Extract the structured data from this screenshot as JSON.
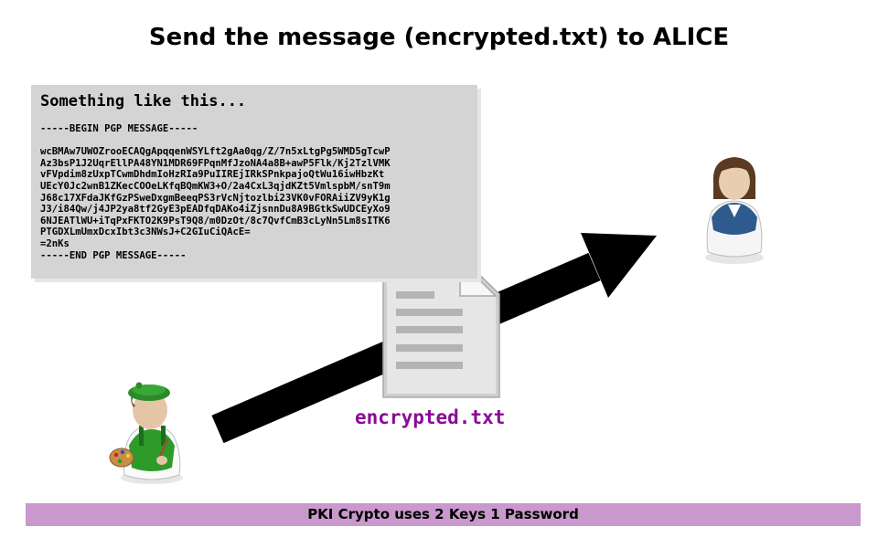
{
  "title": "Send the message (encrypted.txt) to ALICE",
  "pgp_box": {
    "heading": "Something like this...",
    "message_lines": [
      "-----BEGIN PGP MESSAGE-----",
      "",
      "wcBMAw7UWOZrooECAQgApqqenWSYLft2gAa0qg/Z/7n5xLtgPg5WMD5gTcwP",
      "Az3bsP1J2UqrEllPA48YN1MDR69FPqnMfJzoNA4a8B+awP5Flk/Kj2TzlVMK",
      "vFVpdim8zUxpTCwmDhdmIoHzRIa9PuIIREjIRkSPnkpajoQtWu16iwHbzKt",
      "UEcY0Jc2wnB1ZKecCOOeLKfqBQmKW3+O/2a4CxL3qjdKZt5VmlspbM/snT9m",
      "J68c17XFdaJKfGzPSweDxgmBeeqPS3rVcNjtozlbi23VK0vFORAiiZV9yK1g",
      "J3/i84Qw/j4JP2ya8tf2GyE3pEADfqDAKo4iZjsnnDu8A9BGtkSwUDCEyXo9",
      "6NJEATlWU+iTqPxFKTO2K9PsT9Q8/m0DzOt/8c7QvfCmB3cLyNn5Lm8sITK6",
      "PTGDXLmUmxDcxIbt3c3NWsJ+C2GIuCiQAcE=",
      "=2nKs",
      "-----END PGP MESSAGE-----"
    ]
  },
  "file": {
    "name": "encrypted.txt",
    "caption_color": "#8b0a96"
  },
  "footer": {
    "text": "PKI Crypto uses 2 Keys 1 Password",
    "color": "#c998cc"
  },
  "icons": {
    "sender": "painter-person-icon",
    "recipient": "alice-person-icon",
    "document": "text-document-icon",
    "flow": "send-arrow"
  }
}
